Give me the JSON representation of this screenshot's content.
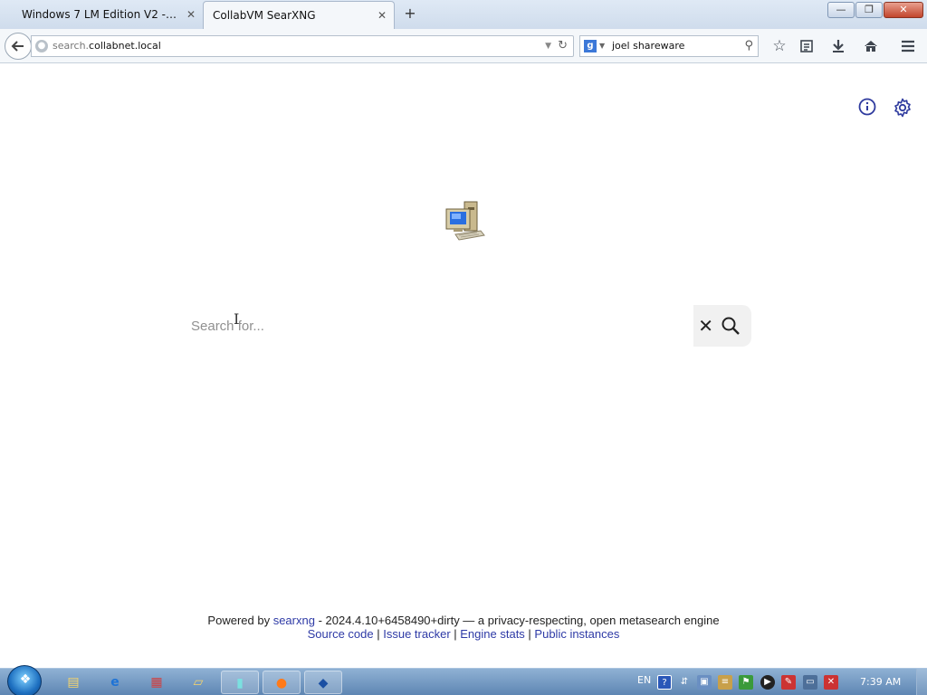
{
  "browser": {
    "tabs": [
      {
        "label": "Windows 7 LM Edition V2 - Col...",
        "active": false
      },
      {
        "label": "CollabVM SearXNG",
        "active": true
      }
    ],
    "new_tab_label": "+",
    "window_controls": {
      "minimize": "—",
      "restore": "❐",
      "close": "✕"
    },
    "url": {
      "prefix": "search.",
      "host": "collabnet.local"
    },
    "search_engine_letter": "g",
    "search_query": "joel shareware"
  },
  "page": {
    "search_placeholder": "Search for...",
    "footer": {
      "powered_by": "Powered by",
      "searxng_link": "searxng",
      "version_text": " - 2024.4.10+6458490+dirty — a privacy-respecting, open metasearch engine",
      "links": [
        "Source code",
        "Issue tracker",
        "Engine stats",
        "Public instances"
      ],
      "separator": " | "
    }
  },
  "taskbar": {
    "language": "EN",
    "clock": "7:39 AM"
  },
  "colors": {
    "link": "#2e3aa6",
    "icon_accent": "#2e3a9e",
    "taskbar": "#6f95c0"
  },
  "icons": {
    "info": "info-icon",
    "settings": "gear-icon",
    "clear": "close-icon",
    "search": "search-icon"
  }
}
